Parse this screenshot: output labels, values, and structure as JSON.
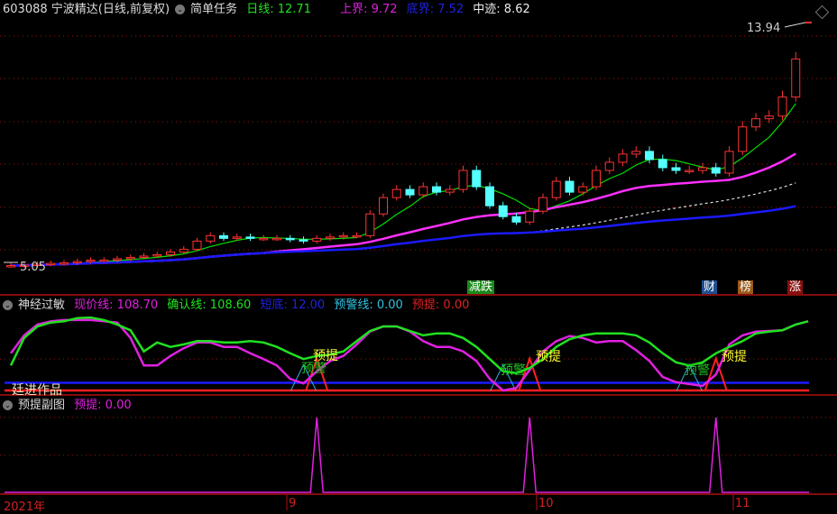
{
  "header": {
    "code_name": "603088 宁波精达(日线,前复权)",
    "strategy": "简单任务",
    "day_line": "日线: 12.71",
    "upper": "上界: 9.72",
    "lower": "底界: 7.52",
    "middle": "中迹: 8.62",
    "max_price_label": "13.94",
    "min_price_label": "5.05"
  },
  "signals": [
    {
      "text": "减跌",
      "color": "#1a8a1a"
    },
    {
      "text": "财",
      "color": "#1e4f8f"
    },
    {
      "text": "榜",
      "color": "#9a5a1a"
    },
    {
      "text": "涨",
      "color": "#8a1010"
    }
  ],
  "indicator": {
    "name": "神经过敏",
    "now_line": "现价线: 108.70",
    "confirm_line": "确认线: 108.60",
    "short_bottom": "短底: 12.00",
    "warn_line": "预警线: 0.00",
    "pre_signal": "预提: 0.00",
    "watermark": "廷进作品",
    "tag_pre": "预提",
    "tag_warn": "预警"
  },
  "sub": {
    "name": "预提副图",
    "pre_signal": "预提: 0.00"
  },
  "axis": {
    "labels": [
      "2021年",
      "9",
      "10",
      "11"
    ]
  },
  "colors": {
    "up": "#ff3232",
    "down": "#54ffff",
    "ma5": "#00e000",
    "ma20": "#ff30ff",
    "ma40": "#dddddd",
    "ma60": "#1a1aff",
    "grid": "#a01010"
  },
  "chart_data": {
    "type": "candlestick",
    "title": "603088 宁波精达 日线",
    "price_range": [
      5.05,
      13.94
    ],
    "closes": [
      5.1,
      5.12,
      5.15,
      5.18,
      5.2,
      5.25,
      5.3,
      5.3,
      5.35,
      5.4,
      5.45,
      5.5,
      5.6,
      5.7,
      6.0,
      6.2,
      6.1,
      6.15,
      6.1,
      6.1,
      6.1,
      6.05,
      6.0,
      6.1,
      6.15,
      6.2,
      6.2,
      7.0,
      7.6,
      7.9,
      7.7,
      8.0,
      7.8,
      7.9,
      8.6,
      8.0,
      7.3,
      6.9,
      6.7,
      7.1,
      7.6,
      8.2,
      7.8,
      8.0,
      8.6,
      8.9,
      9.2,
      9.3,
      9.0,
      8.7,
      8.6,
      8.6,
      8.7,
      8.5,
      9.3,
      10.2,
      10.5,
      10.6,
      11.3,
      12.7
    ],
    "moving_averages": [
      5,
      20,
      40,
      60
    ],
    "indicator_series": [
      {
        "name": "现价线",
        "values": [
          58,
          86,
          103,
          108,
          110,
          110,
          110,
          108,
          106,
          82,
          39,
          39,
          54,
          66,
          75,
          75,
          68,
          68,
          58,
          49,
          39,
          18,
          11,
          30,
          46,
          54,
          72,
          92,
          100,
          100,
          92,
          77,
          68,
          68,
          61,
          46,
          18,
          0,
          4,
          32,
          61,
          77,
          85,
          82,
          75,
          77,
          77,
          63,
          46,
          21,
          13,
          10,
          7,
          25,
          72,
          86,
          92,
          93,
          94,
          103
        ]
      },
      {
        "name": "确认线",
        "values": [
          39,
          82,
          100,
          106,
          108,
          113,
          114,
          110,
          103,
          94,
          61,
          75,
          68,
          72,
          77,
          77,
          75,
          75,
          77,
          75,
          68,
          58,
          49,
          54,
          56,
          61,
          77,
          93,
          100,
          100,
          93,
          86,
          89,
          89,
          82,
          68,
          49,
          30,
          27,
          35,
          49,
          68,
          80,
          86,
          89,
          89,
          89,
          86,
          75,
          58,
          44,
          39,
          44,
          58,
          68,
          77,
          89,
          92,
          94,
          103
        ]
      },
      {
        "name": "短底",
        "value": 12
      },
      {
        "name": "预提",
        "peaks_at_candle": [
          23,
          39,
          53
        ],
        "peak_value": 50
      },
      {
        "name": "预警",
        "peaks_at_candle": [
          22,
          37,
          51
        ],
        "peak_value": 40
      }
    ],
    "sub_series": {
      "name": "预提",
      "peaks_at_candle": [
        23,
        39,
        53
      ],
      "peak_value": 1
    },
    "x_tick_labels": [
      "2021年",
      "9",
      "10",
      "11"
    ]
  }
}
